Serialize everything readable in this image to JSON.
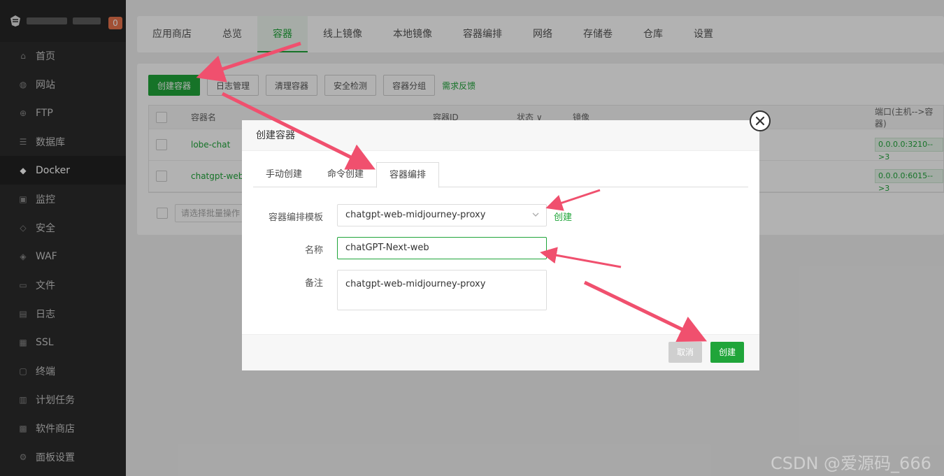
{
  "sidebar": {
    "badge": "0",
    "items": [
      {
        "label": "首页",
        "icon": "home-icon"
      },
      {
        "label": "网站",
        "icon": "globe-icon"
      },
      {
        "label": "FTP",
        "icon": "ftp-icon"
      },
      {
        "label": "数据库",
        "icon": "database-icon"
      },
      {
        "label": "Docker",
        "icon": "docker-icon"
      },
      {
        "label": "监控",
        "icon": "monitor-icon"
      },
      {
        "label": "安全",
        "icon": "shield-icon"
      },
      {
        "label": "WAF",
        "icon": "waf-icon"
      },
      {
        "label": "文件",
        "icon": "folder-icon"
      },
      {
        "label": "日志",
        "icon": "log-icon"
      },
      {
        "label": "SSL",
        "icon": "ssl-icon"
      },
      {
        "label": "终端",
        "icon": "terminal-icon"
      },
      {
        "label": "计划任务",
        "icon": "calendar-icon"
      },
      {
        "label": "软件商店",
        "icon": "apps-icon"
      },
      {
        "label": "面板设置",
        "icon": "gear-icon"
      }
    ]
  },
  "tabs": [
    "应用商店",
    "总览",
    "容器",
    "线上镜像",
    "本地镜像",
    "容器编排",
    "网络",
    "存储卷",
    "仓库",
    "设置"
  ],
  "toolbar": {
    "create": "创建容器",
    "logs": "日志管理",
    "clean": "清理容器",
    "security": "安全检测",
    "group": "容器分组",
    "feedback": "需求反馈"
  },
  "table": {
    "headers": {
      "name": "容器名",
      "id": "容器ID",
      "status": "状态 ∨",
      "image": "镜像",
      "port": "端口(主机-->容器)"
    },
    "rows": [
      {
        "name": "lobe-chat",
        "port": "0.0.0.0:3210-->3"
      },
      {
        "name": "chatgpt-web",
        "port": "0.0.0.0:6015-->3"
      }
    ],
    "batch_placeholder": "请选择批量操作"
  },
  "modal": {
    "title": "创建容器",
    "tabs": [
      "手动创建",
      "命令创建",
      "容器编排"
    ],
    "template_label": "容器编排模板",
    "template_value": "chatgpt-web-midjourney-proxy",
    "template_link": "创建",
    "name_label": "名称",
    "name_value": "chatGPT-Next-web",
    "remark_label": "备注",
    "remark_value": "chatgpt-web-midjourney-proxy",
    "cancel": "取消",
    "confirm": "创建"
  },
  "watermark": "CSDN @爱源码_666",
  "colors": {
    "accent": "#20a53a",
    "sidebar": "#2c2c2c",
    "arrow": "#f0506e"
  }
}
